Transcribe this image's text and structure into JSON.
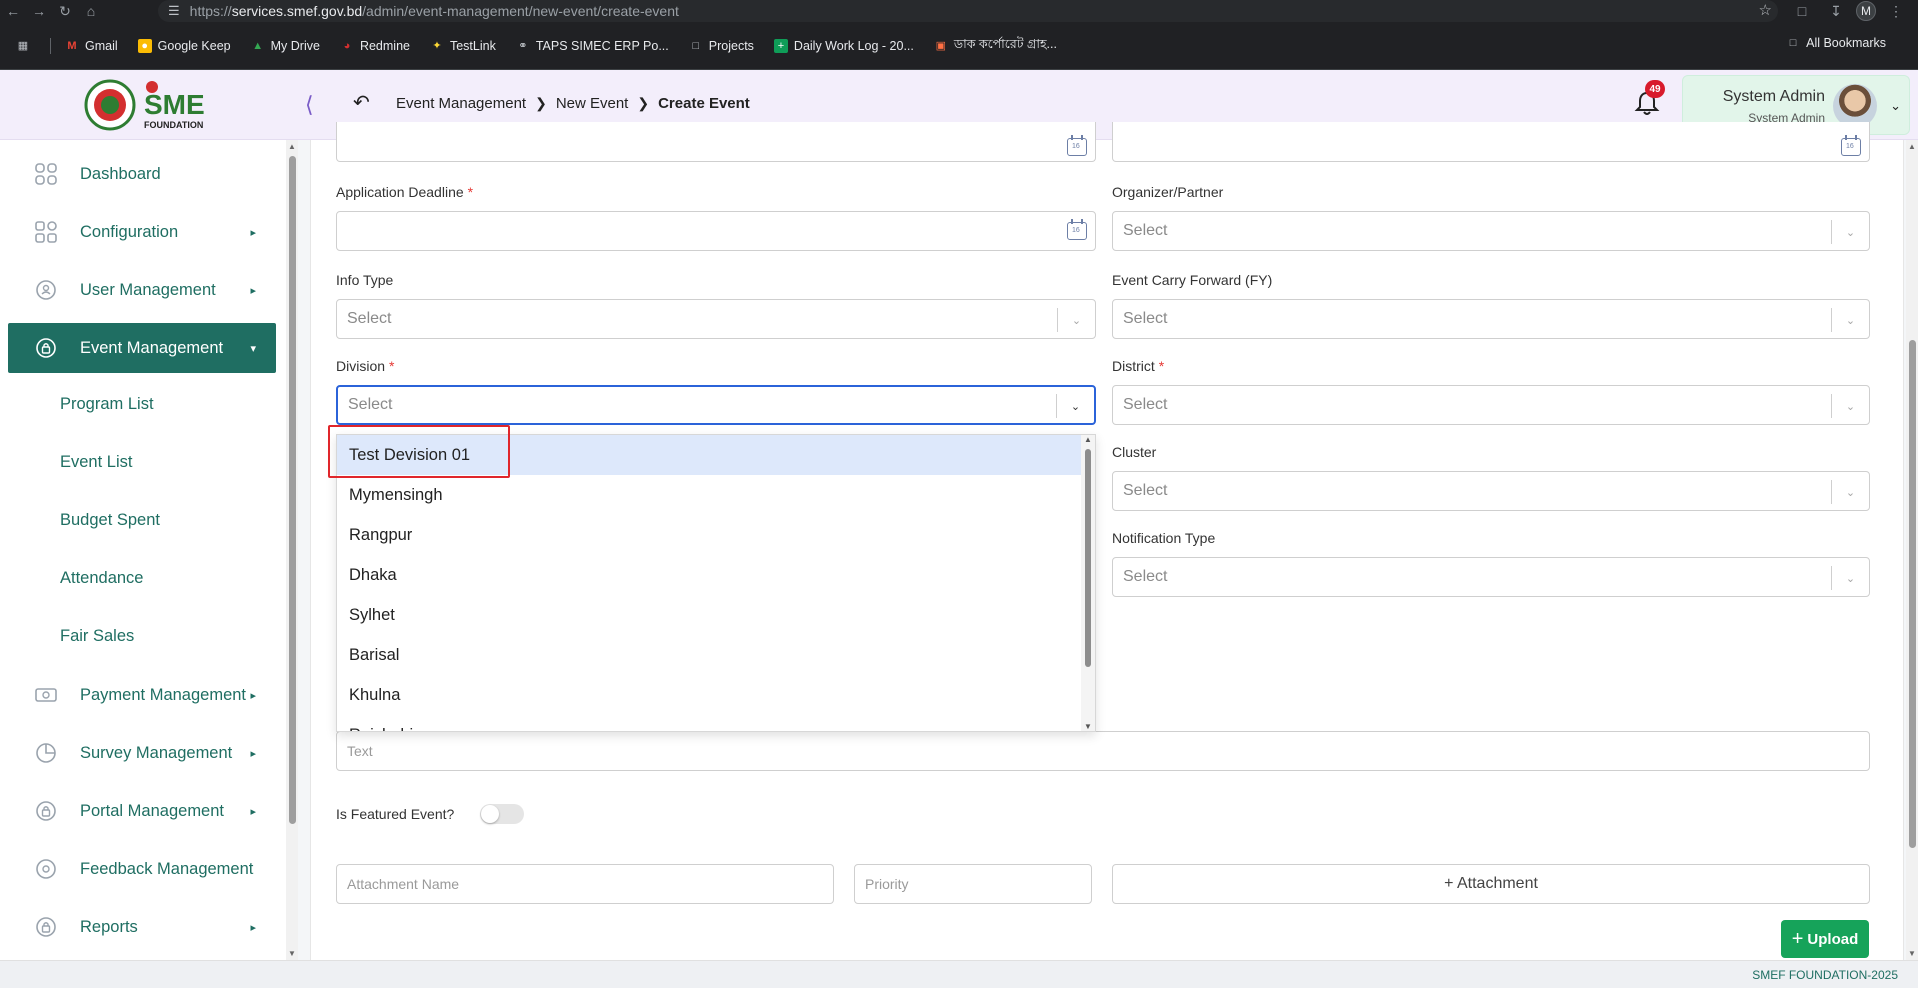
{
  "browser": {
    "url_prefix": "https://",
    "url_domain": "services.smef.gov.bd",
    "url_path": "/admin/event-management/new-event/create-event",
    "profile_initial": "M",
    "bookmarks": [
      "Gmail",
      "Google Keep",
      "My Drive",
      "Redmine",
      "TestLink",
      "TAPS SIMEC ERP Po...",
      "Projects",
      "Daily Work Log - 20...",
      "ডাক কর্পোরেট গ্রাহ..."
    ],
    "all_bookmarks": "All Bookmarks"
  },
  "header": {
    "logo_text_top": "SME",
    "logo_text_bottom": "FOUNDATION",
    "breadcrumb": [
      "Event Management",
      "New Event",
      "Create Event"
    ],
    "notification_count": "49",
    "user_name": "System Admin",
    "user_role": "System Admin"
  },
  "sidebar": {
    "items": [
      {
        "label": "Dashboard"
      },
      {
        "label": "Configuration"
      },
      {
        "label": "User Management"
      },
      {
        "label": "Event Management"
      },
      {
        "label": "Payment Management"
      },
      {
        "label": "Survey Management"
      },
      {
        "label": "Portal Management"
      },
      {
        "label": "Feedback Management"
      },
      {
        "label": "Reports"
      }
    ],
    "subitems": [
      "Program List",
      "Event List",
      "Budget Spent",
      "Attendance",
      "Fair Sales"
    ]
  },
  "form": {
    "application_deadline_label": "Application Deadline",
    "organizer_label": "Organizer/Partner",
    "info_type_label": "Info Type",
    "carry_forward_label": "Event Carry Forward (FY)",
    "division_label": "Division",
    "district_label": "District",
    "cluster_label": "Cluster",
    "notification_type_label": "Notification Type",
    "select_placeholder": "Select",
    "text_placeholder": "Text",
    "featured_label": "Is Featured Event?",
    "attachment_name_placeholder": "Attachment Name",
    "priority_placeholder": "Priority",
    "attachment_button": "+ Attachment",
    "upload_button": "Upload",
    "calendar_day": "16"
  },
  "division_options": [
    "Test Devision 01",
    "Mymensingh",
    "Rangpur",
    "Dhaka",
    "Sylhet",
    "Barisal",
    "Khulna",
    "Rajshahi"
  ],
  "footer": {
    "text": "SMEF FOUNDATION-2025"
  },
  "colors": {
    "brand_green": "#1f6e62",
    "focus_blue": "#2b63d9",
    "highlight_red": "#e0262b",
    "upload_green": "#16a35a"
  }
}
